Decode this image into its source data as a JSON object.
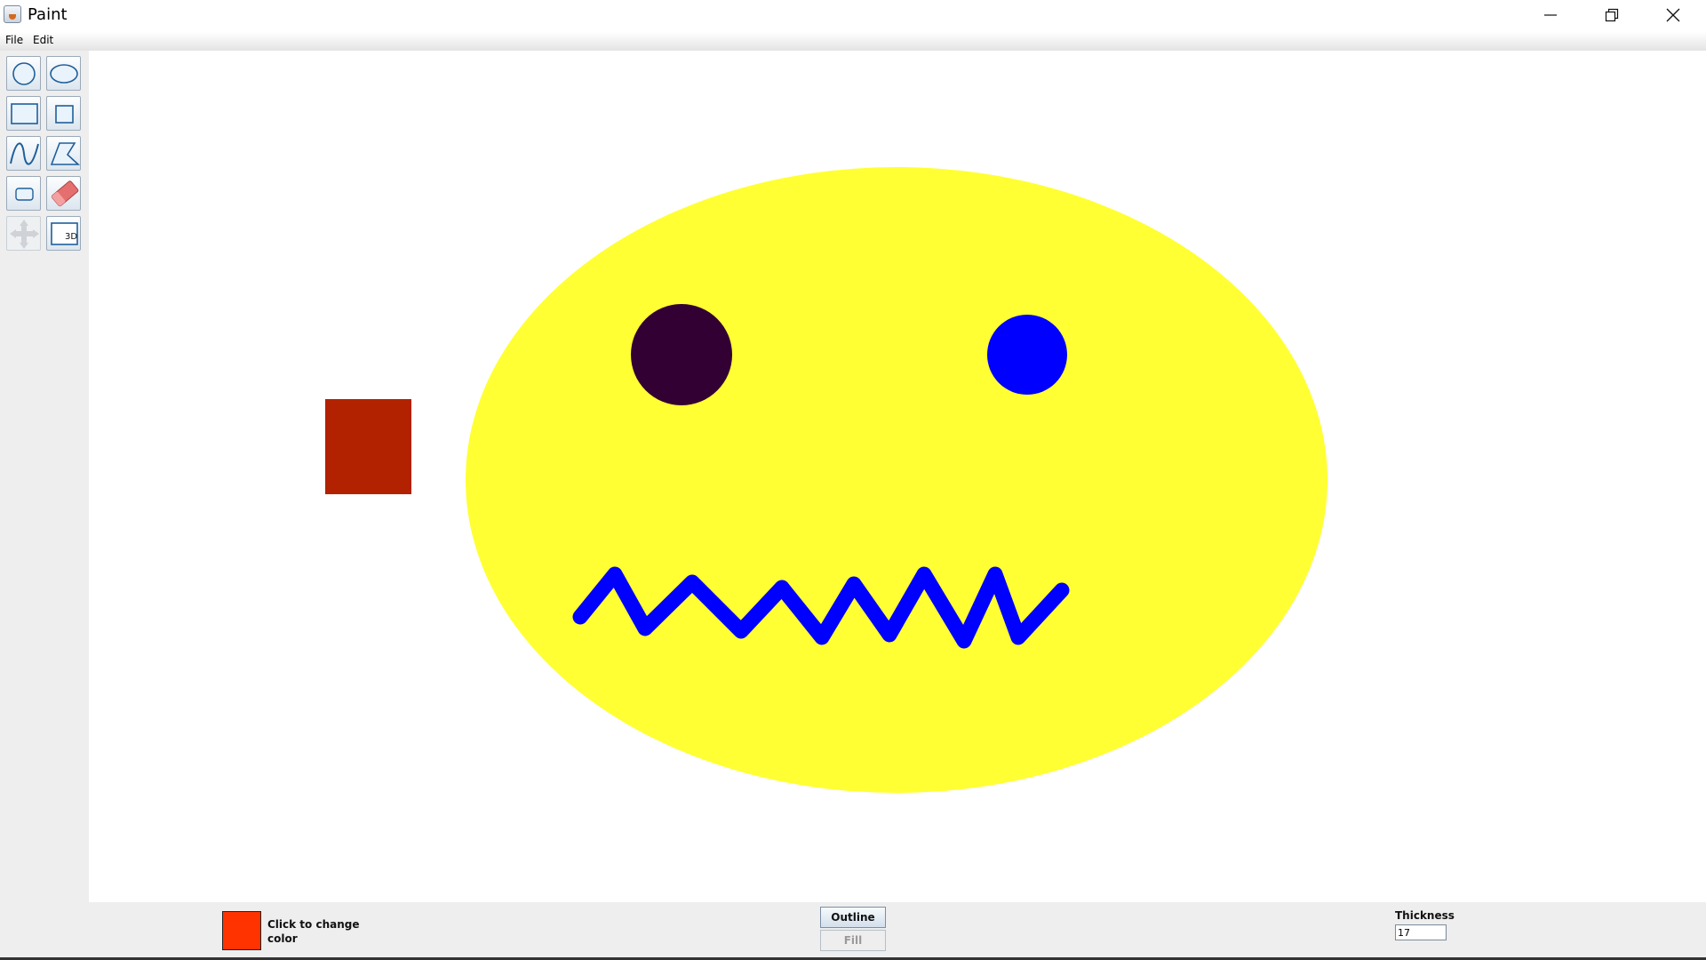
{
  "window": {
    "title": "Paint"
  },
  "menu": {
    "items": [
      "File",
      "Edit"
    ]
  },
  "toolbar": {
    "tools": [
      "circle-tool",
      "ellipse-tool",
      "rectangle-tool",
      "square-tool",
      "freehand-curve-tool",
      "polygon-tool",
      "rounded-rectangle-tool",
      "eraser-tool",
      "move-tool",
      "3d-rectangle-tool"
    ],
    "three_d_label": "3D"
  },
  "canvas": {
    "background": "#ffffff",
    "shapes": [
      {
        "type": "filled-rectangle",
        "color": "#b22100"
      },
      {
        "type": "filled-ellipse",
        "color": "#ffff33"
      },
      {
        "type": "filled-circle",
        "color": "#330033"
      },
      {
        "type": "filled-circle",
        "color": "#0000ff"
      },
      {
        "type": "polyline",
        "color": "#0000ff",
        "thickness": 17
      }
    ]
  },
  "controls": {
    "current_color": "#ff3300",
    "color_label": "Click to change color",
    "outline_label": "Outline",
    "fill_label": "Fill",
    "thickness_label": "Thickness",
    "thickness_value": "17"
  }
}
